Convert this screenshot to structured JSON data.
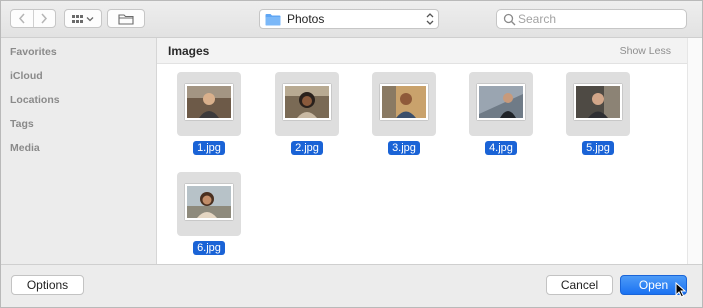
{
  "toolbar": {
    "back_icon": "chevron-left-icon",
    "forward_icon": "chevron-right-icon",
    "view_icon": "icon-grid-view-icon",
    "new_folder_icon": "new-folder-icon",
    "location": "Photos",
    "search_placeholder": "Search"
  },
  "sidebar": {
    "sections": [
      "Favorites",
      "iCloud",
      "Locations",
      "Tags",
      "Media"
    ]
  },
  "content": {
    "group_title": "Images",
    "show_less": "Show Less",
    "files": [
      {
        "name": "1.jpg",
        "selected": true
      },
      {
        "name": "2.jpg",
        "selected": true
      },
      {
        "name": "3.jpg",
        "selected": true
      },
      {
        "name": "4.jpg",
        "selected": true
      },
      {
        "name": "5.jpg",
        "selected": true
      },
      {
        "name": "6.jpg",
        "selected": true
      }
    ]
  },
  "footer": {
    "options": "Options",
    "cancel": "Cancel",
    "open": "Open"
  },
  "colors": {
    "selection": "#1a63d6",
    "folder": "#5fa6f4",
    "primary_button": "#1b72f2"
  }
}
